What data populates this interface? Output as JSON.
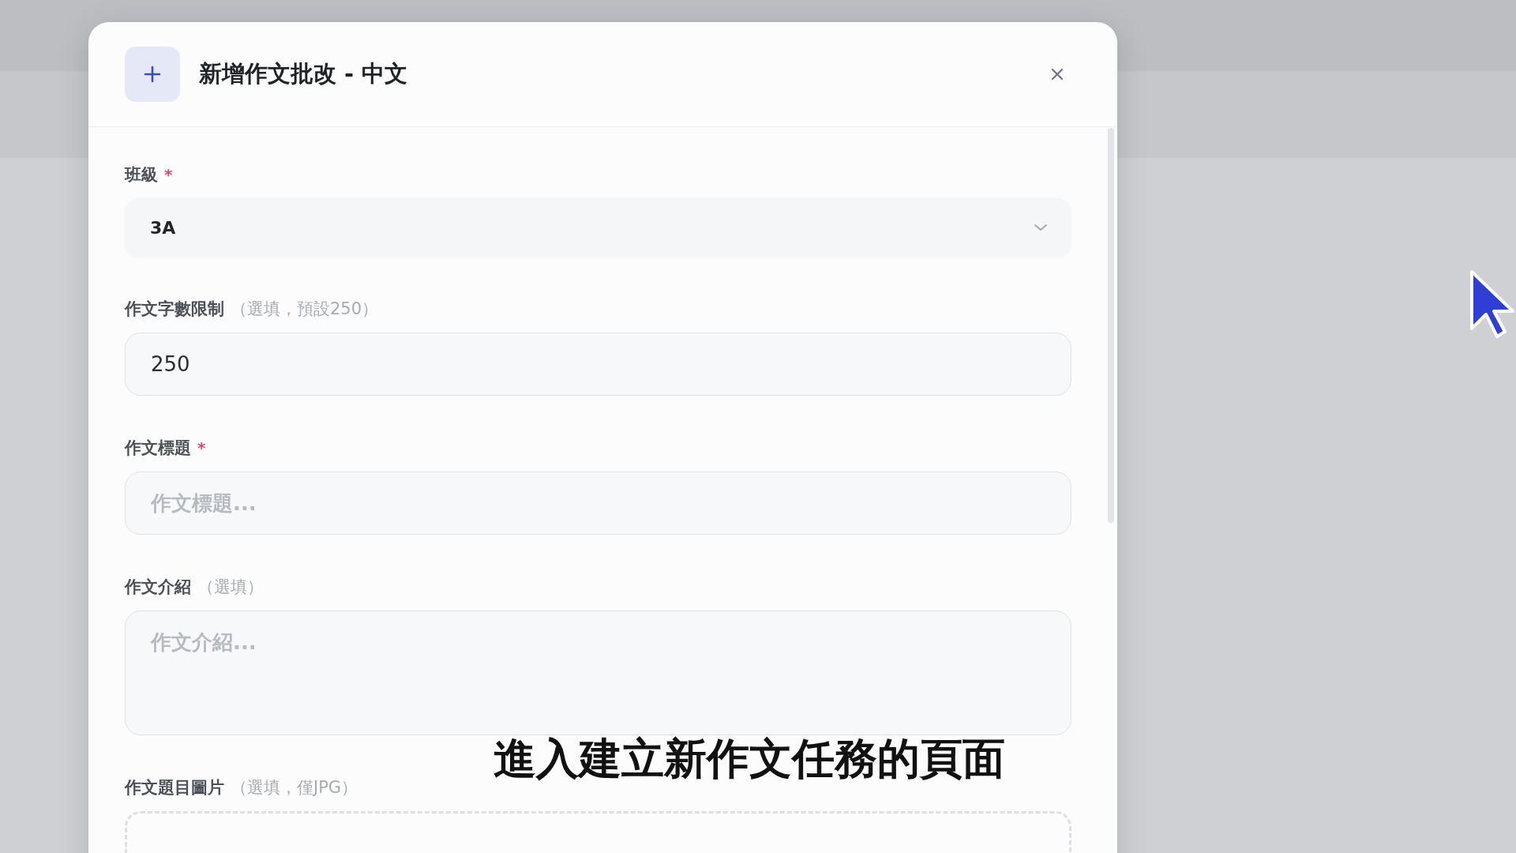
{
  "dialog": {
    "title": "新增作文批改 - 中文"
  },
  "fields": [
    {
      "kind": "select",
      "label": "班級",
      "required_mark": "*",
      "value": "3A"
    },
    {
      "kind": "input",
      "label": "作文字數限制",
      "hint": "（選填，預設250）",
      "value": "250"
    },
    {
      "kind": "input",
      "label": "作文標題",
      "required_mark": "*",
      "placeholder": "作文標題..."
    },
    {
      "kind": "textarea",
      "label": "作文介紹",
      "hint": "（選填）",
      "placeholder": "作文介紹..."
    },
    {
      "kind": "upload",
      "label": "作文題目圖片",
      "hint": "（選填，僅JPG）"
    }
  ],
  "caption": "進入建立新作文任務的頁面"
}
